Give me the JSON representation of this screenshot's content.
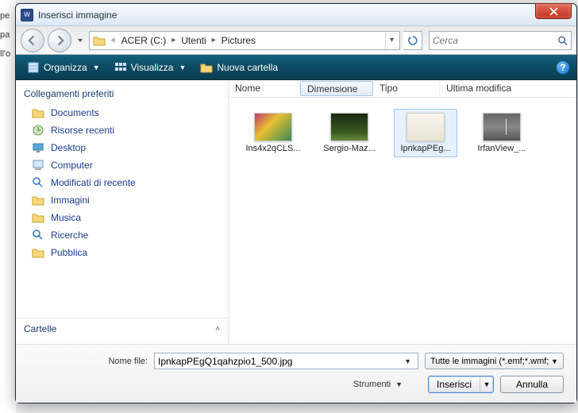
{
  "bg": {
    "pe": "pe",
    "pa": "pa",
    "lo": "ll'o"
  },
  "title": "Inserisci immagine",
  "close_glyph": "X",
  "breadcrumb": {
    "seg1": "ACER (C:)",
    "seg2": "Utenti",
    "seg3": "Pictures"
  },
  "search": {
    "placeholder": "Cerca"
  },
  "toolbar": {
    "organize": "Organizza",
    "views": "Visualizza",
    "newfolder": "Nuova cartella",
    "help": "?"
  },
  "sidebar": {
    "heading": "Collegamenti preferiti",
    "items": [
      {
        "label": "Documents"
      },
      {
        "label": "Risorse recenti"
      },
      {
        "label": "Desktop"
      },
      {
        "label": "Computer"
      },
      {
        "label": "Modificati di recente"
      },
      {
        "label": "Immagini"
      },
      {
        "label": "Musica"
      },
      {
        "label": "Ricerche"
      },
      {
        "label": "Pubblica"
      }
    ],
    "footer": "Cartelle"
  },
  "columns": {
    "nome": "Nome",
    "dimensione": "Dimensione",
    "tipo": "Tipo",
    "ultima": "Ultima modifica"
  },
  "files": [
    {
      "name": "Ins4x2qCLS..."
    },
    {
      "name": "Sergio-Maz..."
    },
    {
      "name": "IpnkapPEg..."
    },
    {
      "name": "IrfanView_..."
    }
  ],
  "bottom": {
    "filename_label": "Nome file:",
    "filename_value": "IpnkapPEgQ1qahzpio1_500.jpg",
    "filetype": "Tutte le immagini (*.emf;*.wmf;",
    "tools": "Strumenti",
    "insert": "Inserisci",
    "cancel": "Annulla"
  }
}
